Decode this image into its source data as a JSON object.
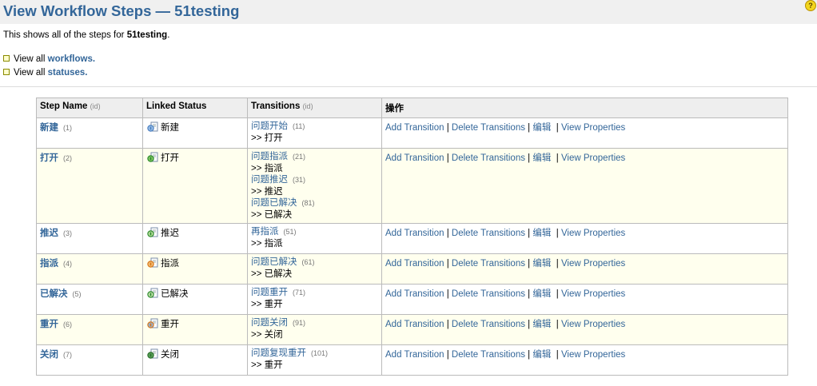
{
  "header": {
    "title": "View Workflow Steps — 51testing",
    "help_icon": "help-icon"
  },
  "description": {
    "prefix": "This shows all of the steps for ",
    "workflow": "51testing",
    "suffix": "."
  },
  "nav": [
    {
      "prefix": "View all ",
      "link": "workflows."
    },
    {
      "prefix": "View all ",
      "link": "statuses."
    }
  ],
  "table": {
    "headers": {
      "step_name": "Step Name",
      "step_name_id": "(id)",
      "linked_status": "Linked Status",
      "transitions": "Transitions",
      "transitions_id": "(id)",
      "actions": "操作"
    },
    "ops": {
      "add": "Add Transition",
      "delete": "Delete Transitions",
      "edit": "编辑",
      "view": "View Properties",
      "sep": "|"
    },
    "rows": [
      {
        "name": "新建",
        "id": "(1)",
        "status": "新建",
        "status_icon": "open-status-icon",
        "transitions": [
          {
            "name": "问题开始",
            "id": "(11)",
            "target": ">> 打开"
          }
        ]
      },
      {
        "name": "打开",
        "id": "(2)",
        "status": "打开",
        "status_icon": "in-progress-status-icon",
        "transitions": [
          {
            "name": "问题指派",
            "id": "(21)",
            "target": ">> 指派"
          },
          {
            "name": "问题推迟",
            "id": "(31)",
            "target": ">> 推迟"
          },
          {
            "name": "问题已解决",
            "id": "(81)",
            "target": ">> 已解决"
          }
        ]
      },
      {
        "name": "推迟",
        "id": "(3)",
        "status": "推迟",
        "status_icon": "deferred-status-icon",
        "transitions": [
          {
            "name": "再指派",
            "id": "(51)",
            "target": ">> 指派"
          }
        ]
      },
      {
        "name": "指派",
        "id": "(4)",
        "status": "指派",
        "status_icon": "assigned-status-icon",
        "transitions": [
          {
            "name": "问题已解决",
            "id": "(61)",
            "target": ">> 已解决"
          }
        ]
      },
      {
        "name": "已解决",
        "id": "(5)",
        "status": "已解决",
        "status_icon": "resolved-status-icon",
        "transitions": [
          {
            "name": "问题重开",
            "id": "(71)",
            "target": ">> 重开"
          }
        ]
      },
      {
        "name": "重开",
        "id": "(6)",
        "status": "重开",
        "status_icon": "reopened-status-icon",
        "transitions": [
          {
            "name": "问题关闭",
            "id": "(91)",
            "target": ">> 关闭"
          }
        ]
      },
      {
        "name": "关闭",
        "id": "(7)",
        "status": "关闭",
        "status_icon": "closed-status-icon",
        "transitions": [
          {
            "name": "问题复现重开",
            "id": "(101)",
            "target": ">> 重开"
          }
        ]
      }
    ]
  },
  "colors": {
    "link": "#336699",
    "row_alt": "#ffffee",
    "header_bg": "#eeeeee"
  }
}
